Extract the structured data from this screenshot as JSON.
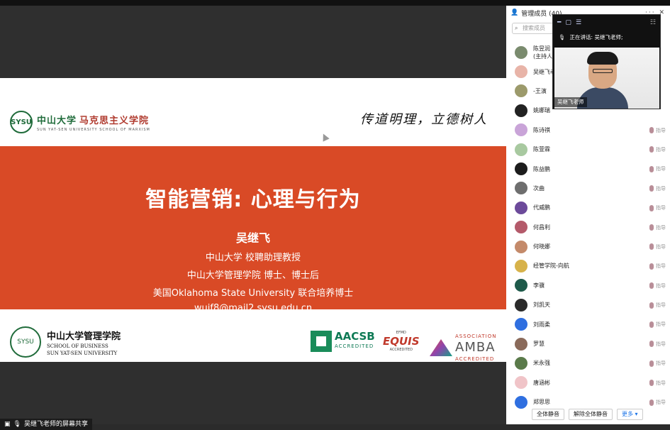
{
  "slide": {
    "school_cn": "中山大学",
    "school_sub": "马克思主义学院",
    "school_en": "SUN YAT-SEN UNIVERSITY   SCHOOL OF MARXISM",
    "motto": "传道明理，立德树人",
    "title": "智能营销: 心理与行为",
    "presenter": "吴继飞",
    "lines": [
      "中山大学 校聘助理教授",
      "中山大学管理学院  博士、博士后",
      "美国Oklahoma State University 联合培养博士",
      "wujf8@mail2.sysu.edu.cn"
    ],
    "biz_cn": "中山大学管理学院",
    "biz_en1": "SCHOOL OF BUSINESS",
    "biz_en2": "SUN YAT-SEN UNIVERSITY",
    "aacsb": "AACSB",
    "aacsb_sub": "ACCREDITED",
    "equis_top": "EFMD",
    "equis": "EQUIS",
    "equis_sub": "ACCREDITED",
    "amba_top": "ASSOCIATION",
    "amba": "AMBA",
    "amba_sub": "ACCREDITED"
  },
  "share_label": "吴继飞老师的屏幕共享",
  "panel": {
    "title": "管理成员 (40)",
    "search_placeholder": "搜索成员",
    "members": [
      {
        "name": "陈昱润\n(主持人)",
        "color": "#7a8b6e"
      },
      {
        "name": "吴继飞老师",
        "color": "#e8b4a8"
      },
      {
        "name": "-王演",
        "color": "#9c9a6b"
      },
      {
        "name": "姚娜瑞",
        "color": "#222222"
      },
      {
        "name": "陈诗祺",
        "color": "#c9a4d8"
      },
      {
        "name": "陈萱霖",
        "color": "#a8c9a0"
      },
      {
        "name": "陈益鹏",
        "color": "#1c1c1c"
      },
      {
        "name": "次曲",
        "color": "#6e6e6e"
      },
      {
        "name": "代威鹏",
        "color": "#6c4a9a"
      },
      {
        "name": "何昌利",
        "color": "#b45a6a"
      },
      {
        "name": "何晓娜",
        "color": "#c48a6a"
      },
      {
        "name": "经管学院-向航",
        "color": "#d7b24a"
      },
      {
        "name": "李骥",
        "color": "#1e5a4a"
      },
      {
        "name": "刘凯天",
        "color": "#2a2a2a"
      },
      {
        "name": "刘雨柔",
        "color": "#2f6fe0"
      },
      {
        "name": "罗慧",
        "color": "#8a6a5a"
      },
      {
        "name": "米永强",
        "color": "#5a7a4a"
      },
      {
        "name": "唐涵彬",
        "color": "#f0c4c8"
      },
      {
        "name": "郑思思",
        "color": "#2f6fe0"
      }
    ],
    "mic_label": "指导",
    "btn_mute_all": "全体静音",
    "btn_unmute_all": "解除全体静音",
    "btn_more": "更多 ▾"
  },
  "video": {
    "speaking": "正在讲话: 吴继飞老师;",
    "name": "吴继飞老师"
  }
}
